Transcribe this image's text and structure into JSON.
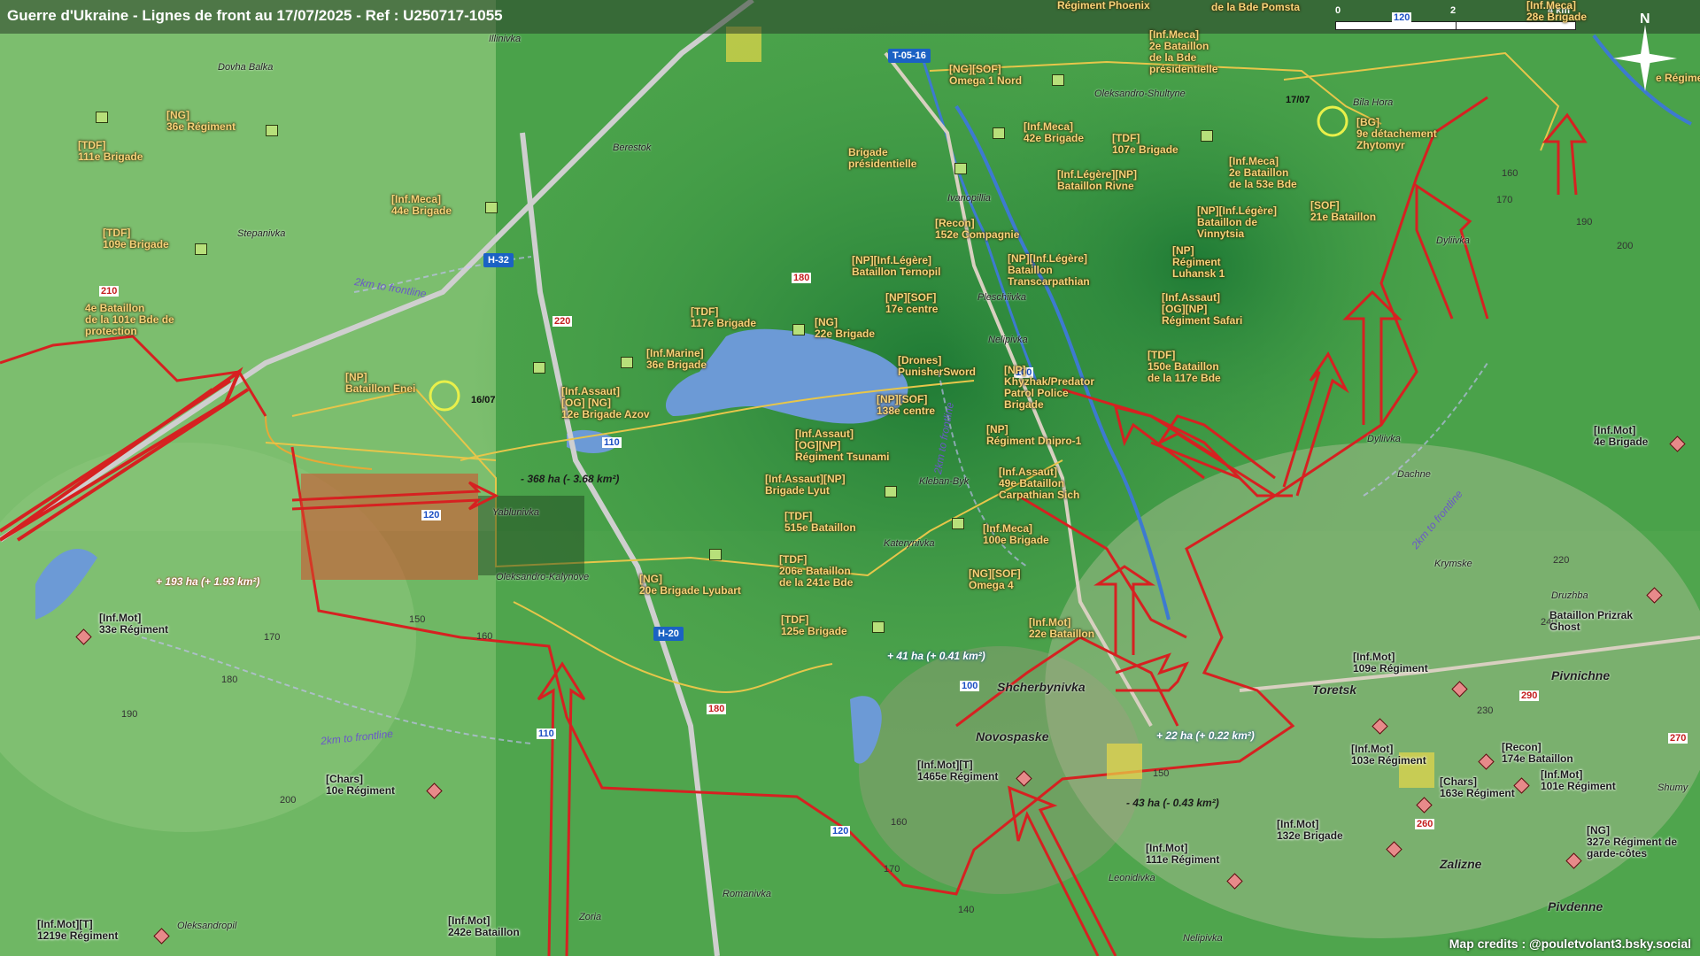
{
  "title": "Guerre d'Ukraine - Lignes de front au 17/07/2025 - Ref : U250717-1055",
  "scale": {
    "start": "0",
    "mid": "2",
    "end": "4 km"
  },
  "compass": "N",
  "credit": "Map credits : @pouletvolant3.bsky.social",
  "frontline_label": "2km to frontline",
  "dates": {
    "west": "16/07",
    "east": "17/07"
  },
  "roads": [
    "T-05-16",
    "H-32",
    "H-20"
  ],
  "altitudes": {
    "a210": "210",
    "a220": "220",
    "a180": "180",
    "a110a": "110",
    "a120a": "120",
    "a150": "150",
    "a160a": "160",
    "a170a": "170",
    "a190a": "190",
    "a200": "200",
    "a100a": "100",
    "a100b": "100",
    "a140": "140",
    "a160b": "160",
    "a180b": "180",
    "a170b": "170",
    "a190b": "190",
    "a200b": "200",
    "a220b": "220",
    "a230": "230",
    "a240": "240",
    "a260": "260",
    "a270": "270",
    "a290": "290",
    "a150b": "150",
    "a160c": "160",
    "a120b": "120",
    "a110b": "110",
    "a120c": "120",
    "a170c": "170",
    "a180c": "180"
  },
  "gains": {
    "g1": "- 368 ha (- 3.68 km²)",
    "g2": "+ 193 ha (+ 1.93 km²)",
    "g3": "+ 41 ha (+ 0.41 km²)",
    "g4": "+ 22 ha (+ 0.22 km²)",
    "g5": "- 43 ha (- 0.43 km²)"
  },
  "towns": {
    "illinivka": "Illinivka",
    "dovha_balka": "Dovha Balka",
    "berestok": "Berestok",
    "stepanivka": "Stepanivka",
    "ivanopillia": "Ivanopillia",
    "pleschiivka": "Pleschiivka",
    "nelipivka": "Nelipivka",
    "kleban_byk": "Kleban-Byk",
    "katerynivka": "Katerynivka",
    "yablunivka": "Yablunivka",
    "oleksandro_kalynove": "Oleksandro-Kalynove",
    "shcherbynivka": "Shcherbynivka",
    "novospaske": "Novospaske",
    "leonidivka": "Leonidivka",
    "oleksandro_shultyne": "Oleksandro-Shultyne",
    "bila_hora": "Bila Hora",
    "dyliivka": "Dyliivka",
    "dyliivka2": "Dyliivka",
    "dachne": "Dachne",
    "krymske": "Krymske",
    "druzhba": "Druzhba",
    "toretsk": "Toretsk",
    "pivnichne": "Pivnichne",
    "shumy": "Shumy",
    "zalizne": "Zalizne",
    "pivdenne": "Pivdenne",
    "romanivka": "Romanivka",
    "oleksandropil": "Oleksandropil",
    "zoria": "Zoria",
    "nelipivka2": "Nelipivka"
  },
  "ua_units": [
    {
      "id": "u1",
      "text": "[NG]\n36e Régiment"
    },
    {
      "id": "u2",
      "text": "[TDF]\n111e Brigade"
    },
    {
      "id": "u3",
      "text": "[Inf.Meca]\n44e Brigade"
    },
    {
      "id": "u4",
      "text": "[TDF]\n109e Brigade"
    },
    {
      "id": "u5",
      "text": "4e Bataillon\nde la 101e Bde de\nprotection"
    },
    {
      "id": "u6",
      "text": "[NP]\nBataillon Enei"
    },
    {
      "id": "u7",
      "text": "[Inf.Assaut]\n[OG] [NG]\n12e Brigade Azov"
    },
    {
      "id": "u8",
      "text": "[Inf.Marine]\n36e Brigade"
    },
    {
      "id": "u9",
      "text": "[TDF]\n117e Brigade"
    },
    {
      "id": "u10",
      "text": "[NG]\n22e Brigade"
    },
    {
      "id": "u11",
      "text": "[NG][SOF]\nOmega 1 Nord"
    },
    {
      "id": "u12",
      "text": "Brigade\nprésidentielle"
    },
    {
      "id": "u13",
      "text": "[Inf.Meca]\n42e Brigade"
    },
    {
      "id": "u14",
      "text": "[Inf.Meca]\n2e Bataillon\nde la Bde\nprésidentielle"
    },
    {
      "id": "u15",
      "text": "[TDF]\n107e Brigade"
    },
    {
      "id": "u16",
      "text": "[Inf.Légère][NP]\nBataillon Rivne"
    },
    {
      "id": "u17",
      "text": "[Inf.Meca]\n2e Bataillon\nde la 53e Bde"
    },
    {
      "id": "u18",
      "text": "[BG]\n9e détachement\nZhytomyr"
    },
    {
      "id": "u19",
      "text": "[SOF]\n21e Bataillon"
    },
    {
      "id": "u20",
      "text": "[Recon]\n152e Compagnie"
    },
    {
      "id": "u21",
      "text": "[NP][Inf.Légère]\nBataillon de\nVinnytsia"
    },
    {
      "id": "u22",
      "text": "[NP][Inf.Légère]\nBataillon Ternopil"
    },
    {
      "id": "u23",
      "text": "[NP][Inf.Légère]\nBataillon\nTranscarpathian"
    },
    {
      "id": "u24",
      "text": "[NP]\nRégiment\nLuhansk 1"
    },
    {
      "id": "u25",
      "text": "[NP][SOF]\n17e centre"
    },
    {
      "id": "u26",
      "text": "[Inf.Assaut]\n[OG][NP]\nRégiment Safari"
    },
    {
      "id": "u27",
      "text": "[Drones]\nPunisherSword"
    },
    {
      "id": "u28",
      "text": "[NP]\nKhyzhak/Predator\nPatrol Police\nBrigade"
    },
    {
      "id": "u29",
      "text": "[TDF]\n150e Bataillon\nde la 117e Bde"
    },
    {
      "id": "u30",
      "text": "[NP][SOF]\n138e centre"
    },
    {
      "id": "u31",
      "text": "[NP]\nRégiment Dnipro-1"
    },
    {
      "id": "u32",
      "text": "[Inf.Assaut]\n[OG][NP]\nRégiment Tsunami"
    },
    {
      "id": "u33",
      "text": "[Inf.Assaut][NP]\nBrigade Lyut"
    },
    {
      "id": "u34",
      "text": "[Inf.Assaut]\n49e Bataillon\nCarpathian Sich"
    },
    {
      "id": "u35",
      "text": "[TDF]\n515e Bataillon"
    },
    {
      "id": "u36",
      "text": "[Inf.Meca]\n100e Brigade"
    },
    {
      "id": "u37",
      "text": "[TDF]\n206e Bataillon\nde la 241e Bde"
    },
    {
      "id": "u38",
      "text": "[NG][SOF]\nOmega 4"
    },
    {
      "id": "u39",
      "text": "[NG]\n20e Brigade Lyubart"
    },
    {
      "id": "u40",
      "text": "[TDF]\n125e Brigade"
    },
    {
      "id": "u41",
      "text": "[Inf.Mot]\n22e Bataillon"
    },
    {
      "id": "u42",
      "text": "Régiment Phoenix"
    },
    {
      "id": "u43",
      "text": "de la Bde Pomsta"
    },
    {
      "id": "u44",
      "text": "[Inf.Meca]\n28e Brigade"
    },
    {
      "id": "u45",
      "text": "e Régime"
    }
  ],
  "ru_units": [
    {
      "id": "r1",
      "text": "[Inf.Mot]\n33e Régiment"
    },
    {
      "id": "r2",
      "text": "[Chars]\n10e Régiment"
    },
    {
      "id": "r3",
      "text": "[Inf.Mot][T]\n1219e Régiment"
    },
    {
      "id": "r4",
      "text": "[Inf.Mot]\n242e Bataillon"
    },
    {
      "id": "r5",
      "text": "[Inf.Mot][T]\n1465e Régiment"
    },
    {
      "id": "r6",
      "text": "[Inf.Mot]\n111e Régiment"
    },
    {
      "id": "r7",
      "text": "[Inf.Mot]\n132e Brigade"
    },
    {
      "id": "r8",
      "text": "[Inf.Mot]\n103e Régiment"
    },
    {
      "id": "r9",
      "text": "[Chars]\n163e Régiment"
    },
    {
      "id": "r10",
      "text": "[Recon]\n174e Bataillon"
    },
    {
      "id": "r11",
      "text": "[Inf.Mot]\n101e Régiment"
    },
    {
      "id": "r12",
      "text": "[NG]\n327e Régiment de\ngarde-côtes"
    },
    {
      "id": "r13",
      "text": "[Inf.Mot]\n109e Régiment"
    },
    {
      "id": "r14",
      "text": "Bataillon Prizrak\nGhost"
    },
    {
      "id": "r15",
      "text": "[Inf.Mot]\n4e Brigade"
    }
  ]
}
